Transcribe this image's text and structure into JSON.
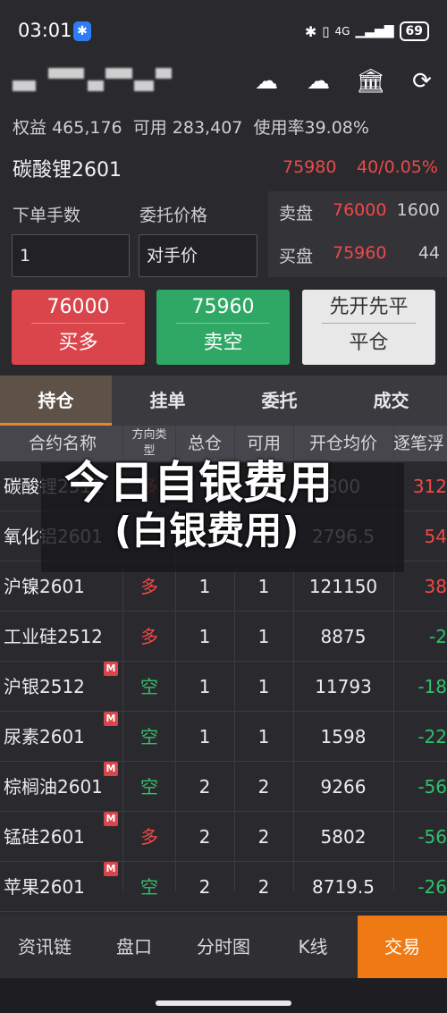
{
  "status": {
    "time": "03:01",
    "network": "4G",
    "battery": "69"
  },
  "account": {
    "equity_label": "权益",
    "equity": "465,176",
    "available_label": "可用",
    "available": "283,407",
    "usage_label": "使用率",
    "usage": "39.08%"
  },
  "contract": {
    "name": "碳酸锂2601",
    "price": "75980",
    "change": "40/0.05%"
  },
  "order": {
    "qty_label": "下单手数",
    "qty_value": "1",
    "price_label": "委托价格",
    "price_value": "对手价"
  },
  "depth": [
    {
      "label": "卖盘",
      "price": "76000",
      "qty": "1600"
    },
    {
      "label": "买盘",
      "price": "75960",
      "qty": "44"
    }
  ],
  "buttons": {
    "buy": {
      "price": "76000",
      "label": "买多"
    },
    "sell": {
      "price": "75960",
      "label": "卖空"
    },
    "close": {
      "price": "先开先平",
      "label": "平仓"
    }
  },
  "tabs": [
    "持仓",
    "挂单",
    "委托",
    "成交"
  ],
  "table": {
    "headers": {
      "name": "合约名称",
      "dir": "方向类型",
      "total": "总仓",
      "avail": "可用",
      "avg": "开仓均价",
      "pnl": "逐笔浮"
    },
    "rows": [
      {
        "name": "碳酸锂2512",
        "m": false,
        "dir": "多",
        "total": "",
        "avail": "",
        "avg": "800",
        "pnl": "312"
      },
      {
        "name": "氧化铝2601",
        "m": false,
        "dir": "",
        "total": "",
        "avail": "",
        "avg": "2796.5",
        "pnl": "54"
      },
      {
        "name": "沪镍2601",
        "m": false,
        "dir": "多",
        "total": "1",
        "avail": "1",
        "avg": "121150",
        "pnl": "38"
      },
      {
        "name": "工业硅2512",
        "m": false,
        "dir": "多",
        "total": "1",
        "avail": "1",
        "avg": "8875",
        "pnl": "-2"
      },
      {
        "name": "沪银2512",
        "m": true,
        "dir": "空",
        "total": "1",
        "avail": "1",
        "avg": "11793",
        "pnl": "-18"
      },
      {
        "name": "尿素2601",
        "m": true,
        "dir": "空",
        "total": "1",
        "avail": "1",
        "avg": "1598",
        "pnl": "-22"
      },
      {
        "name": "棕榈油2601",
        "m": true,
        "dir": "空",
        "total": "2",
        "avail": "2",
        "avg": "9266",
        "pnl": "-56"
      },
      {
        "name": "锰硅2601",
        "m": true,
        "dir": "多",
        "total": "2",
        "avail": "2",
        "avg": "5802",
        "pnl": "-56"
      },
      {
        "name": "苹果2601",
        "m": true,
        "dir": "空",
        "total": "2",
        "avail": "2",
        "avg": "8719.5",
        "pnl": "-26"
      }
    ],
    "m_tag": "M"
  },
  "overlay": {
    "title": "今日自银费用",
    "subtitle": "(白银费用)"
  },
  "nav": [
    "资讯链",
    "盘口",
    "分时图",
    "K线",
    "交易"
  ],
  "colors": {
    "up": "#f04848",
    "down": "#2fc06a",
    "accent": "#ef7a14"
  }
}
